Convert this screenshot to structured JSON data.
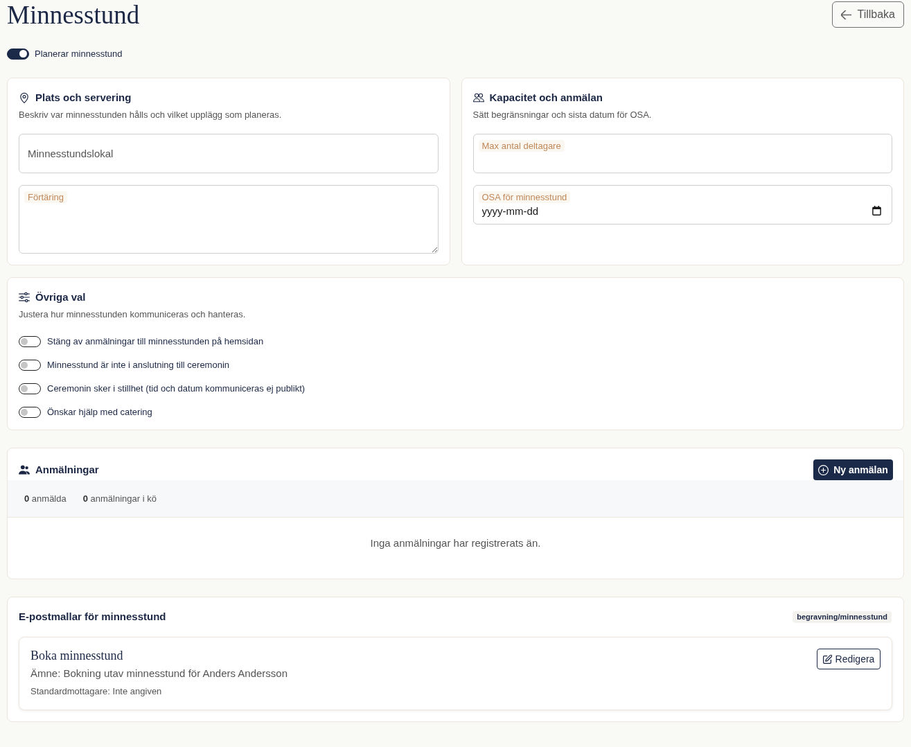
{
  "page": {
    "title": "Minnesstund",
    "back_button": "Tillbaka"
  },
  "planning_toggle": {
    "label": "Planerar minnesstund",
    "on": true
  },
  "location_card": {
    "title": "Plats och servering",
    "subtitle": "Beskriv var minnesstunden hålls och vilket upplägg som planeras.",
    "fields": [
      {
        "kind": "text",
        "placeholder": "Minnesstundslokal"
      },
      {
        "kind": "textarea",
        "label": "Förtäring"
      }
    ]
  },
  "capacity_card": {
    "title": "Kapacitet och anmälan",
    "subtitle": "Sätt begränsningar och sista datum för OSA.",
    "fields": [
      {
        "kind": "number",
        "label": "Max antal deltagare"
      },
      {
        "kind": "date",
        "label": "OSA för minnesstund",
        "placeholder": "yyyy-mm-dd"
      }
    ]
  },
  "options_card": {
    "title": "Övriga val",
    "subtitle": "Justera hur minnesstunden kommuniceras och hanteras.",
    "toggles": [
      {
        "label": "Stäng av anmälningar till minnesstunden på hemsidan",
        "on": false
      },
      {
        "label": "Minnesstund är inte i anslutning till ceremonin",
        "on": false
      },
      {
        "label": "Ceremonin sker i stillhet (tid och datum kommuniceras ej publikt)",
        "on": false
      },
      {
        "label": "Önskar hjälp med catering",
        "on": false
      }
    ]
  },
  "registrations": {
    "title": "Anmälningar",
    "new_button": "Ny anmälan",
    "stats": [
      "**0** anmälda",
      "**0** anmälningar i kö"
    ],
    "empty_message": "Inga anmälningar har registrerats än."
  },
  "email_templates": {
    "title": "E-postmallar för minnesstund",
    "tag": "begravning/minnesstund",
    "templates": [
      {
        "name": "Boka minnesstund",
        "subject": "Ämne: Bokning utav minnesstund för Anders Andersson",
        "recipients": "Standardmottagare: Inte angiven",
        "edit_button": "Redigera"
      }
    ]
  }
}
